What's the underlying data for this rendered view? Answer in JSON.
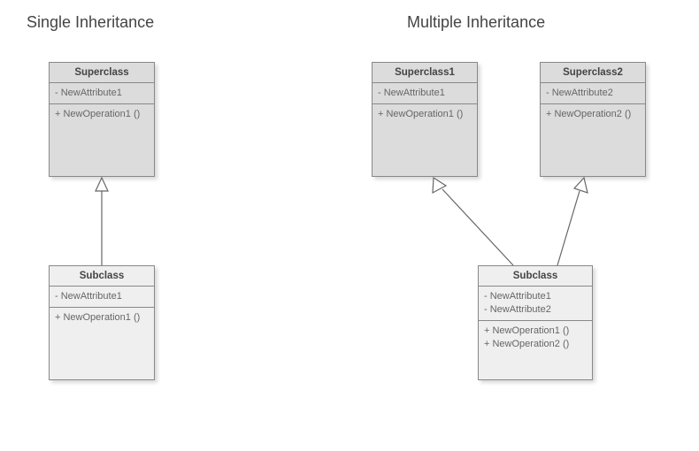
{
  "headings": {
    "single": "Single Inheritance",
    "multiple": "Multiple Inheritance"
  },
  "single": {
    "superclass": {
      "name": "Superclass",
      "attr1": "- NewAttribute1",
      "op1": "+ NewOperation1 ()"
    },
    "subclass": {
      "name": "Subclass",
      "attr1": "- NewAttribute1",
      "op1": "+ NewOperation1 ()"
    }
  },
  "multiple": {
    "superclass1": {
      "name": "Superclass1",
      "attr1": "- NewAttribute1",
      "op1": "+ NewOperation1 ()"
    },
    "superclass2": {
      "name": "Superclass2",
      "attr1": "- NewAttribute2",
      "op1": "+ NewOperation2 ()"
    },
    "subclass": {
      "name": "Subclass",
      "attr1": "- NewAttribute1",
      "attr2": "- NewAttribute2",
      "op1": "+ NewOperation1 ()",
      "op2": "+ NewOperation2 ()"
    }
  }
}
